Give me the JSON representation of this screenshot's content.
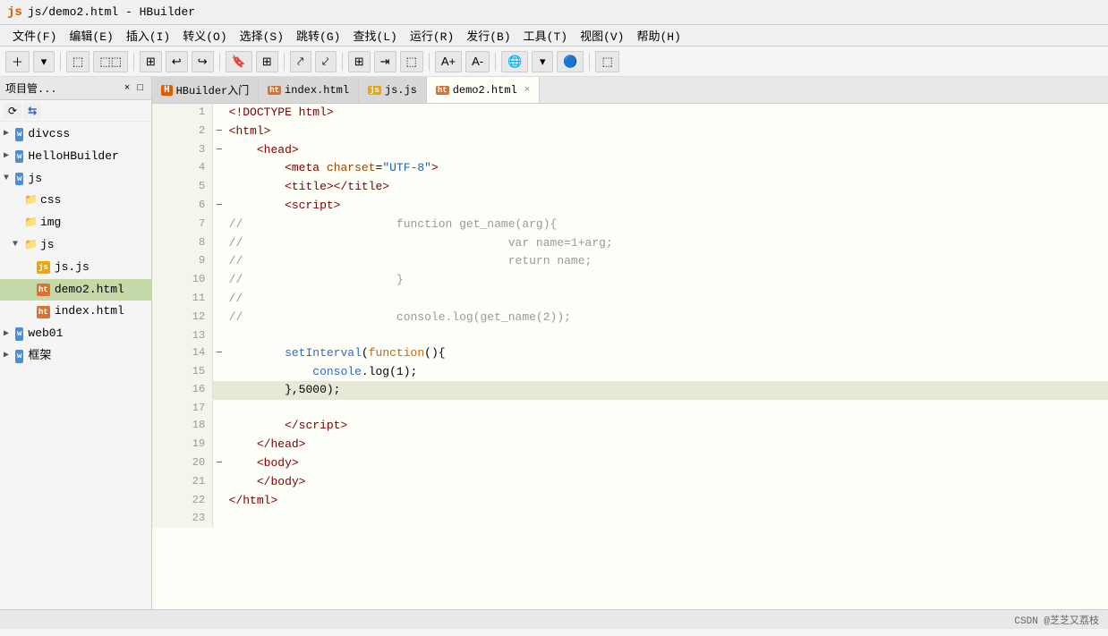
{
  "titleBar": {
    "icon": "js",
    "title": "js/demo2.html  -  HBuilder"
  },
  "menuBar": {
    "items": [
      "文件(F)",
      "编辑(E)",
      "插入(I)",
      "转义(O)",
      "选择(S)",
      "跳转(G)",
      "查找(L)",
      "运行(R)",
      "发行(B)",
      "工具(T)",
      "视图(V)",
      "帮助(H)"
    ]
  },
  "tabs": [
    {
      "id": "hbuilder-intro",
      "label": "HBuilder入门",
      "icon": "H",
      "active": false,
      "closable": false
    },
    {
      "id": "index-html",
      "label": "index.html",
      "icon": "html",
      "active": false,
      "closable": false
    },
    {
      "id": "js-js",
      "label": "js.js",
      "icon": "js",
      "active": false,
      "closable": false
    },
    {
      "id": "demo2-html",
      "label": "demo2.html",
      "icon": "html",
      "active": true,
      "closable": true
    }
  ],
  "sidebar": {
    "title": "项目管...",
    "tree": [
      {
        "level": 0,
        "type": "folder",
        "name": "divcss",
        "icon": "w",
        "expanded": false,
        "arrow": "▶"
      },
      {
        "level": 0,
        "type": "folder",
        "name": "HelloHBuilder",
        "icon": "w",
        "expanded": false,
        "arrow": "▶"
      },
      {
        "level": 0,
        "type": "folder",
        "name": "js",
        "icon": "w",
        "expanded": true,
        "arrow": "▼"
      },
      {
        "level": 1,
        "type": "folder",
        "name": "css",
        "icon": "folder",
        "expanded": false,
        "arrow": ""
      },
      {
        "level": 1,
        "type": "folder",
        "name": "img",
        "icon": "folder",
        "expanded": false,
        "arrow": ""
      },
      {
        "level": 1,
        "type": "folder",
        "name": "js",
        "icon": "folder",
        "expanded": true,
        "arrow": "▼"
      },
      {
        "level": 2,
        "type": "file",
        "name": "js.js",
        "icon": "js",
        "active": false
      },
      {
        "level": 2,
        "type": "file",
        "name": "demo2.html",
        "icon": "html",
        "active": true
      },
      {
        "level": 2,
        "type": "file",
        "name": "index.html",
        "icon": "html",
        "active": false
      },
      {
        "level": 0,
        "type": "folder",
        "name": "web01",
        "icon": "w",
        "expanded": false,
        "arrow": "▶"
      },
      {
        "level": 0,
        "type": "folder",
        "name": "框架",
        "icon": "w",
        "expanded": false,
        "arrow": "▶"
      }
    ]
  },
  "codeLines": [
    {
      "num": 1,
      "fold": "",
      "code": "&lt;!DOCTYPE html&gt;",
      "highlight": false
    },
    {
      "num": 2,
      "fold": "⊟",
      "code": "&lt;html&gt;",
      "highlight": false
    },
    {
      "num": 3,
      "fold": "⊟",
      "code": "    &lt;head&gt;",
      "highlight": false
    },
    {
      "num": 4,
      "fold": "",
      "code": "        &lt;meta charset=\"UTF-8\"&gt;",
      "highlight": false
    },
    {
      "num": 5,
      "fold": "",
      "code": "        &lt;title&gt;&lt;/title&gt;",
      "highlight": false
    },
    {
      "num": 6,
      "fold": "⊟",
      "code": "        &lt;script&gt;",
      "highlight": false
    },
    {
      "num": 7,
      "fold": "",
      "code": "// \t\t\tfunction get_name(arg){",
      "highlight": false,
      "isComment": true
    },
    {
      "num": 8,
      "fold": "",
      "code": "//\t\t\t\t\tvar name=1+arg;",
      "highlight": false,
      "isComment": true
    },
    {
      "num": 9,
      "fold": "",
      "code": "//\t\t\t\t\treturn name;",
      "highlight": false,
      "isComment": true
    },
    {
      "num": 10,
      "fold": "",
      "code": "//\t\t\t}",
      "highlight": false,
      "isComment": true
    },
    {
      "num": 11,
      "fold": "",
      "code": "//",
      "highlight": false,
      "isComment": true
    },
    {
      "num": 12,
      "fold": "",
      "code": "//\t\t\tconsole.log(get_name(2));",
      "highlight": false,
      "isComment": true
    },
    {
      "num": 13,
      "fold": "",
      "code": "",
      "highlight": false
    },
    {
      "num": 14,
      "fold": "⊟",
      "code": "        setInterval(function(){",
      "highlight": false
    },
    {
      "num": 15,
      "fold": "",
      "code": "            console.log(1);",
      "highlight": false
    },
    {
      "num": 16,
      "fold": "",
      "code": "        },5000);",
      "highlight": true
    },
    {
      "num": 17,
      "fold": "",
      "code": "",
      "highlight": false
    },
    {
      "num": 18,
      "fold": "",
      "code": "        &lt;/script&gt;",
      "highlight": false
    },
    {
      "num": 19,
      "fold": "",
      "code": "    &lt;/head&gt;",
      "highlight": false
    },
    {
      "num": 20,
      "fold": "⊟",
      "code": "    &lt;body&gt;",
      "highlight": false
    },
    {
      "num": 21,
      "fold": "",
      "code": "    &lt;/body&gt;",
      "highlight": false
    },
    {
      "num": 22,
      "fold": "",
      "code": "&lt;/html&gt;",
      "highlight": false
    },
    {
      "num": 23,
      "fold": "",
      "code": "",
      "highlight": false
    }
  ],
  "statusBar": {
    "text": "CSDN @芝芝又荔枝"
  }
}
